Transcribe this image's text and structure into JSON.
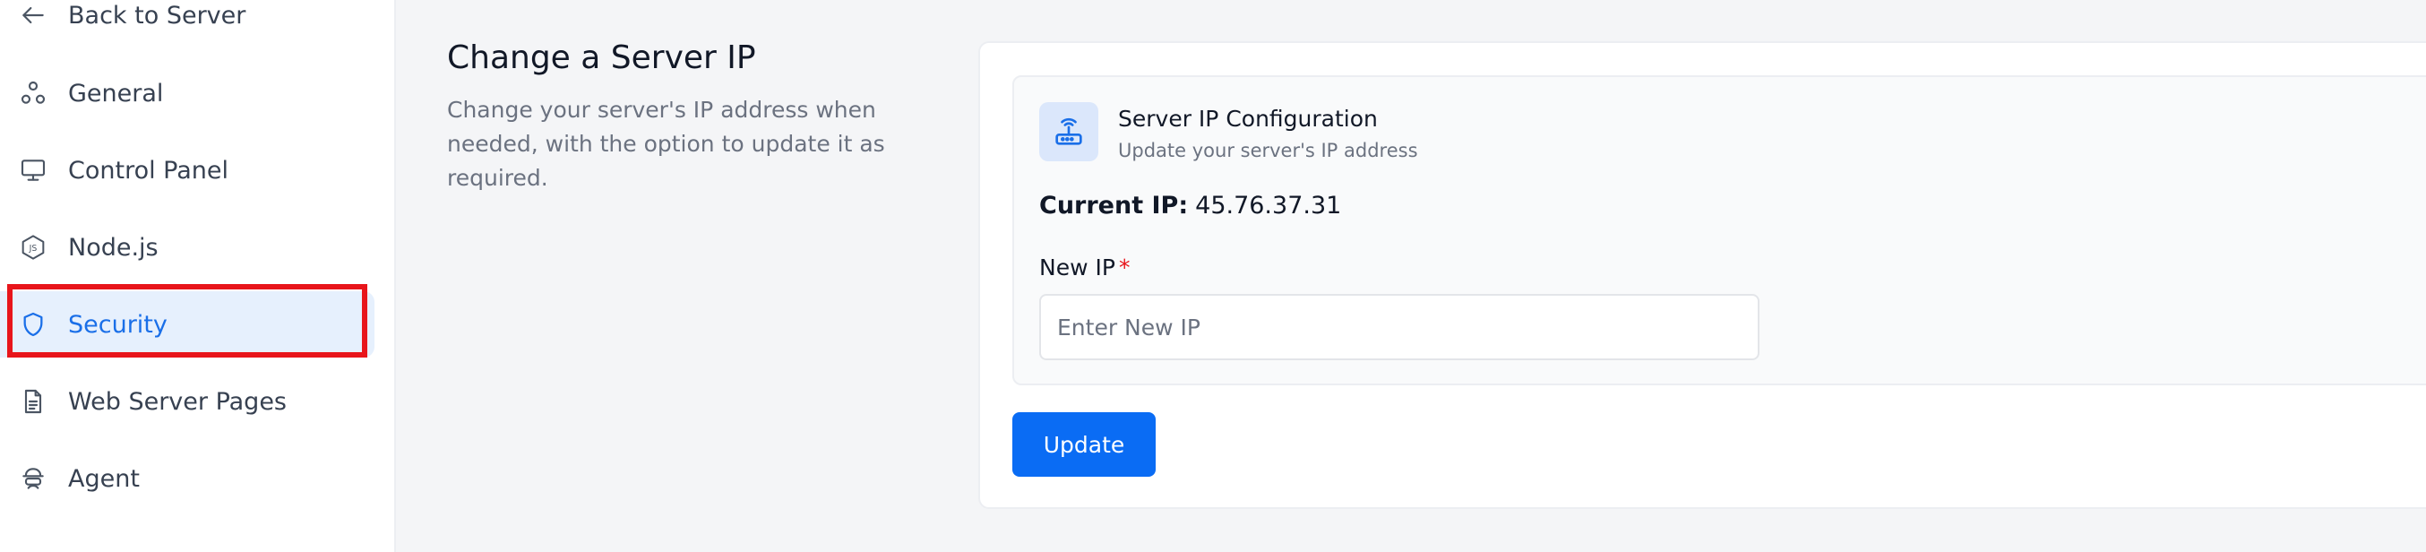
{
  "sidebar": {
    "items": [
      {
        "label": "Back to Server",
        "icon": "arrow-left-icon"
      },
      {
        "label": "General",
        "icon": "nodes-icon"
      },
      {
        "label": "Control Panel",
        "icon": "monitor-icon"
      },
      {
        "label": "Node.js",
        "icon": "nodejs-icon"
      },
      {
        "label": "Security",
        "icon": "shield-icon",
        "active": true
      },
      {
        "label": "Web Server Pages",
        "icon": "document-icon"
      },
      {
        "label": "Agent",
        "icon": "agent-icon"
      }
    ]
  },
  "section": {
    "title": "Change a Server IP",
    "description": "Change your server's IP address when needed, with the option to update it as required."
  },
  "config": {
    "title": "Server IP Configuration",
    "subtitle": "Update your server's IP address",
    "icon": "router-icon"
  },
  "current_ip": {
    "label": "Current IP:",
    "value": "45.76.37.31"
  },
  "new_ip": {
    "label": "New IP",
    "required_mark": "*",
    "placeholder": "Enter New IP"
  },
  "actions": {
    "update_label": "Update"
  },
  "colors": {
    "accent": "#0a6cf4",
    "active_bg": "#e6f0fd",
    "highlight": "#e8151b"
  }
}
